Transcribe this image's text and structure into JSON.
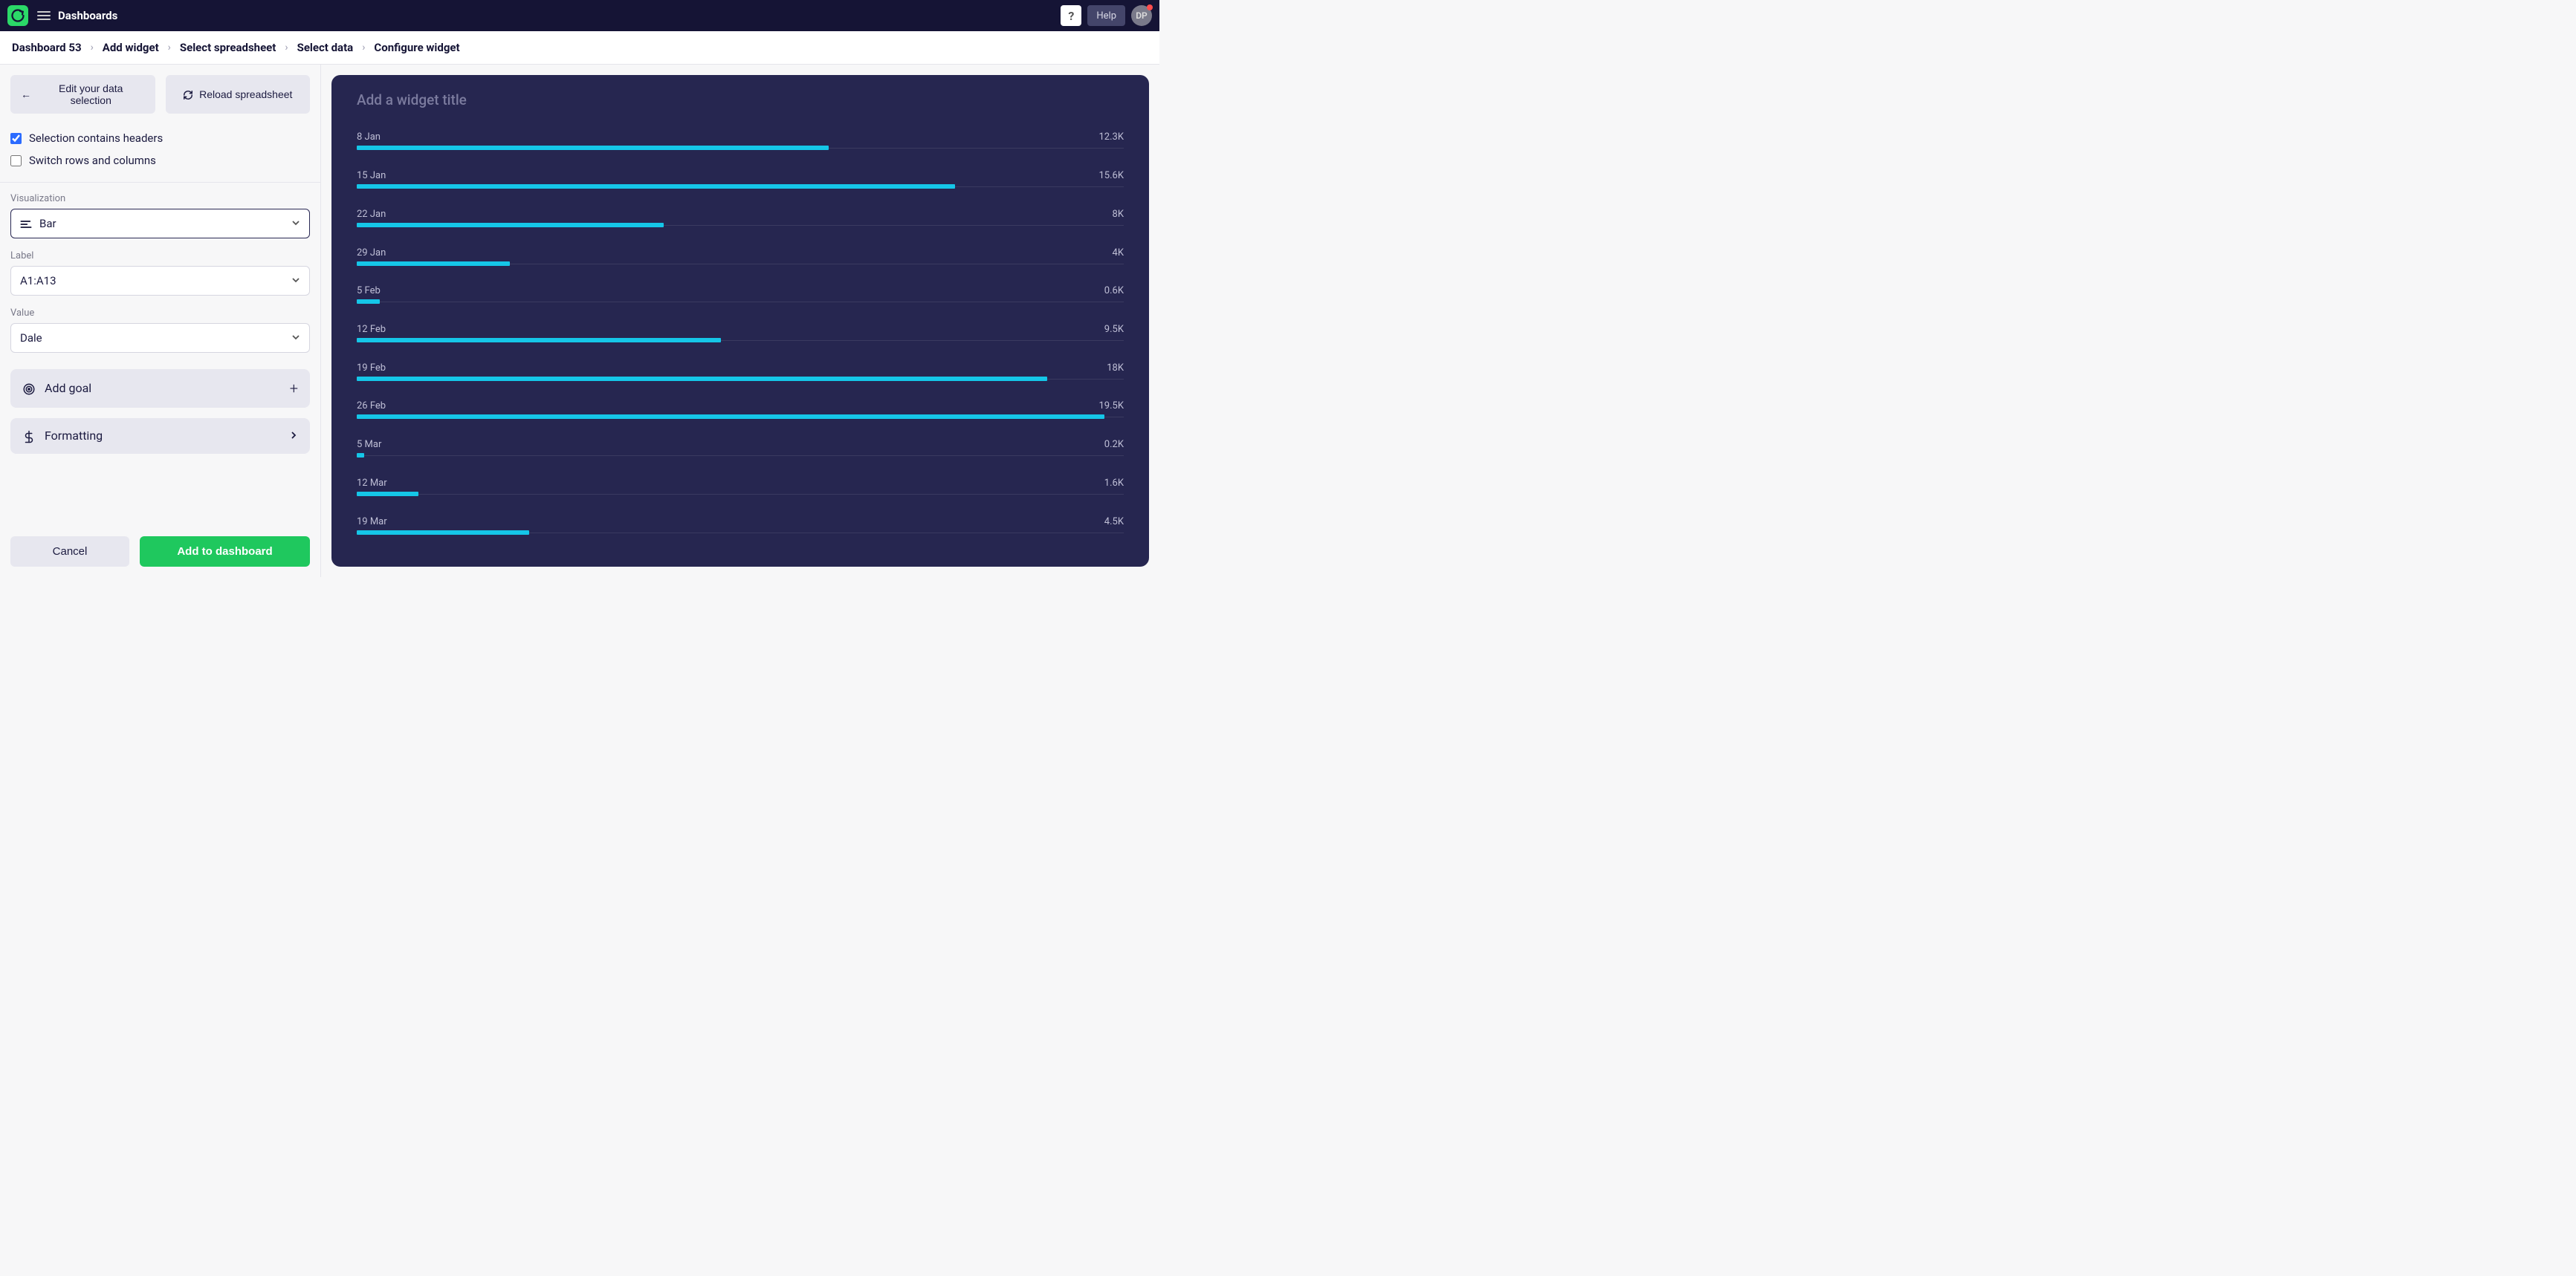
{
  "chart_data": {
    "type": "bar",
    "orientation": "horizontal",
    "categories": [
      "8 Jan",
      "15 Jan",
      "22 Jan",
      "29 Jan",
      "5 Feb",
      "12 Feb",
      "19 Feb",
      "26 Feb",
      "5 Mar",
      "12 Mar",
      "19 Mar"
    ],
    "values": [
      12300,
      15600,
      8000,
      4000,
      600,
      9500,
      18000,
      19500,
      200,
      1600,
      4500
    ],
    "value_labels": [
      "12.3K",
      "15.6K",
      "8K",
      "4K",
      "0.6K",
      "9.5K",
      "18K",
      "19.5K",
      "0.2K",
      "1.6K",
      "4.5K"
    ],
    "title": "Add a widget title",
    "xlabel": "",
    "ylabel": "",
    "xlim": [
      0,
      20000
    ],
    "bar_color": "#15c6e8"
  },
  "topbar": {
    "section": "Dashboards",
    "help_label": "Help",
    "qmark": "?",
    "avatar_initials": "DP"
  },
  "breadcrumbs": {
    "items": [
      "Dashboard 53",
      "Add widget",
      "Select spreadsheet",
      "Select data",
      "Configure widget"
    ]
  },
  "sidebar": {
    "edit_label": "Edit your data selection",
    "reload_label": "Reload spreadsheet",
    "headers_label": "Selection contains headers",
    "switch_label": "Switch rows and columns",
    "visualization_label": "Visualization",
    "visualization_value": "Bar",
    "label_label": "Label",
    "label_value": "A1:A13",
    "value_label": "Value",
    "value_value": "Dale",
    "add_goal_label": "Add goal",
    "formatting_label": "Formatting",
    "cancel_label": "Cancel",
    "add_label": "Add to dashboard"
  },
  "widget": {
    "title_placeholder": "Add a widget title"
  }
}
